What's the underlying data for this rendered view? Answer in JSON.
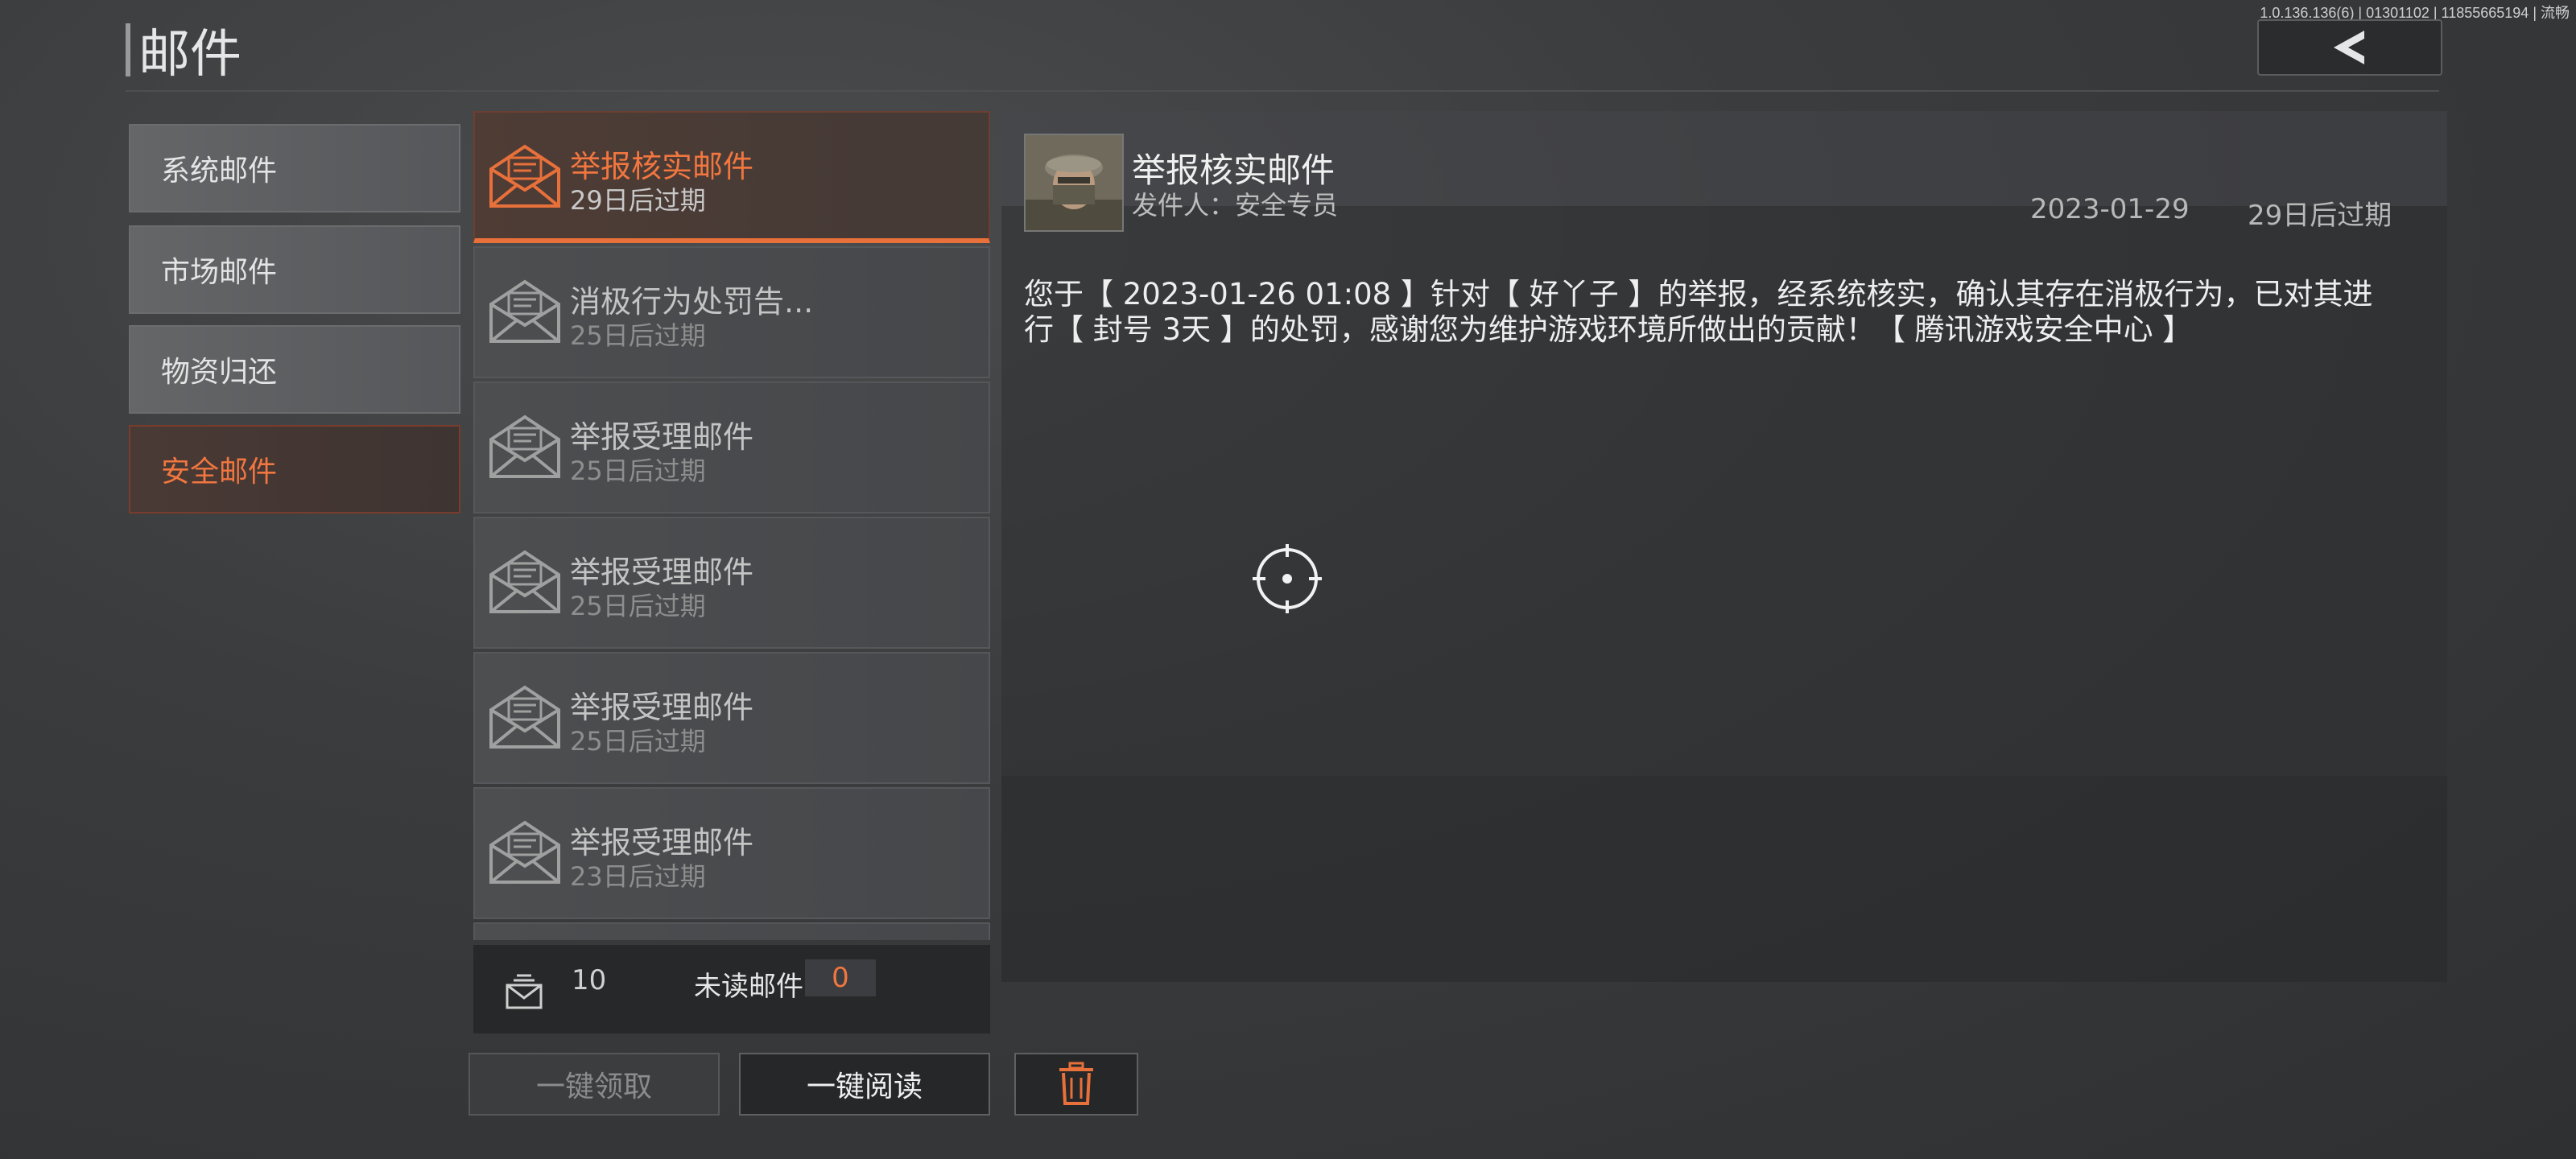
{
  "version": "1.0.136.136(6) | 01301102 | 11855665194 | 流畅",
  "page_title": "邮件",
  "categories": [
    {
      "label": "系统邮件",
      "active": false
    },
    {
      "label": "市场邮件",
      "active": false
    },
    {
      "label": "物资归还",
      "active": false
    },
    {
      "label": "安全邮件",
      "active": true
    }
  ],
  "mails": [
    {
      "title": "举报核实邮件",
      "expire": "29日后过期",
      "active": true
    },
    {
      "title": "消极行为处罚告...",
      "expire": "25日后过期",
      "active": false
    },
    {
      "title": "举报受理邮件",
      "expire": "25日后过期",
      "active": false
    },
    {
      "title": "举报受理邮件",
      "expire": "25日后过期",
      "active": false
    },
    {
      "title": "举报受理邮件",
      "expire": "25日后过期",
      "active": false
    },
    {
      "title": "举报受理邮件",
      "expire": "23日后过期",
      "active": false
    }
  ],
  "footer": {
    "mail_count": "10",
    "unread_label": "未读邮件",
    "unread_count": "0"
  },
  "buttons": {
    "collect_all": "一键领取",
    "read_all": "一键阅读"
  },
  "detail": {
    "title": "举报核实邮件",
    "sender": "发件人：安全专员",
    "date": "2023-01-29",
    "expire": "29日后过期",
    "content": "您于【 2023-01-26 01:08 】针对【 好丫子 】的举报，经系统核实，确认其存在消极行为，已对其进行【 封号 3天 】的处罚，感谢您为维护游戏环境所做出的贡献！【 腾讯游戏安全中心 】"
  },
  "colors": {
    "accent": "#f2763f",
    "active_border": "#e8703a"
  }
}
